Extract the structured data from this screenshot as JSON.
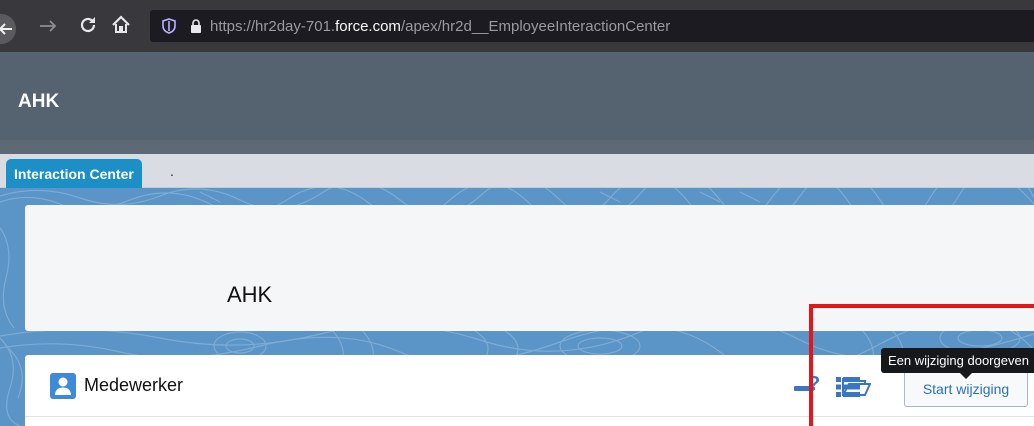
{
  "browser": {
    "url_prefix": "https://hr2day-701.",
    "url_domain": "force.com",
    "url_path": "/apex/hr2d__EmployeeInteractionCenter"
  },
  "app": {
    "header_title": "AHK"
  },
  "tabs": {
    "active_label": "Interaction Center",
    "extra_label": "."
  },
  "employee_card": {
    "name": "AHK"
  },
  "section": {
    "title": "Medewerker",
    "help_symbol": "?",
    "start_button_label": "Start wijziging",
    "tooltip_text": "Een wijziging doorgeven"
  },
  "colors": {
    "accent_blue": "#1b8fc6",
    "header_gray": "#55626f",
    "highlight_red": "#e4161b"
  }
}
